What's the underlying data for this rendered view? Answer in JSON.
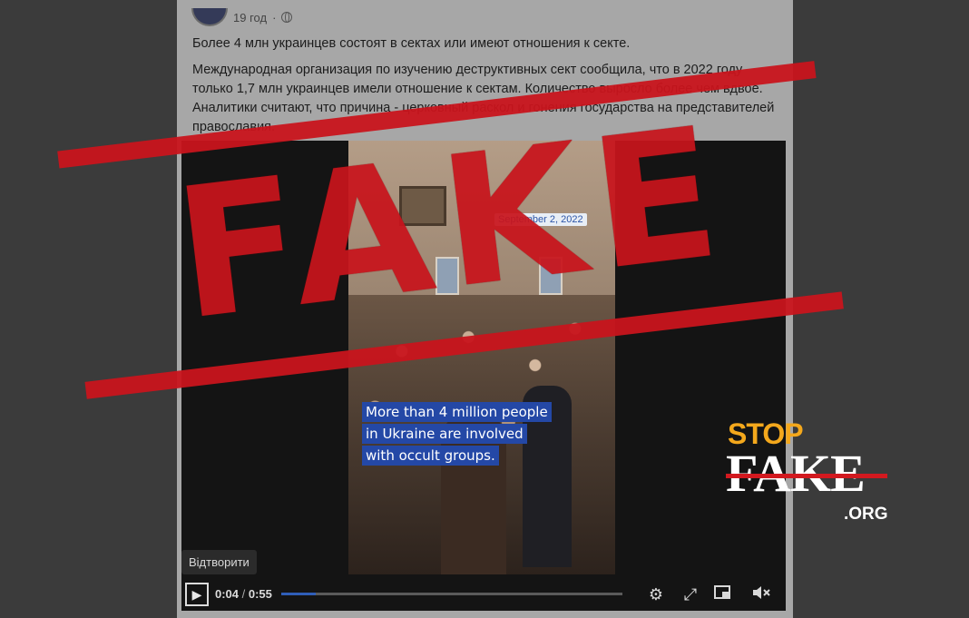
{
  "post": {
    "time": "19 год",
    "separator": "·",
    "paragraph1": "Более 4 млн украинцев состоят в сектах или имеют отношения к секте.",
    "paragraph2": "Международная организация по изучению деструктивных сект сообщила, что в 2022 году только 1,7 млн украинцев имели отношение к сектам. Количество выросло более чем вдвое. Аналитики считают, что причина - церковный раскол и гонения государства на представителей православия."
  },
  "video": {
    "date_badge": "September 2, 2022",
    "caption_lines": [
      "More than 4 million people",
      "in Ukraine are involved",
      "with occult groups."
    ],
    "play_label": "Відтворити",
    "time_current": "0:04",
    "time_separator": " / ",
    "time_total": "0:55",
    "progress": 0.1
  },
  "stamp": {
    "text": "FAKE",
    "color": "#c8141c"
  },
  "logo": {
    "stop": "STOP",
    "fake": "FAKE",
    "org": ".ORG",
    "stop_color": "#f4a81c",
    "strike_color": "#d2191f"
  },
  "icons": {
    "play": "play-icon",
    "settings": "gear-icon",
    "fullscreen": "expand-icon",
    "pip": "picture-in-picture-icon",
    "mute": "volume-muted-icon"
  }
}
